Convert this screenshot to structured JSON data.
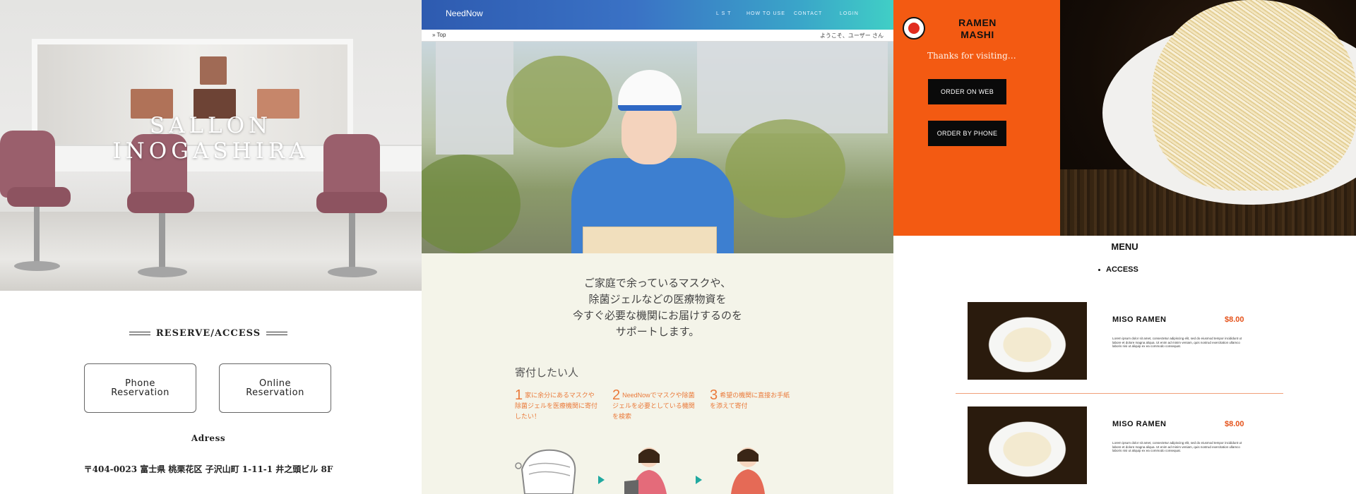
{
  "salon": {
    "title_line1": "SALLON",
    "title_line2": "INOGASHIRA",
    "section_title": "RESERVE/ACCESS",
    "phone_button": "Phone\nReservation",
    "online_button": "Online\nReservation",
    "address_heading": "Adress",
    "address": "〒404-0023 富士県 桃栗花区 子沢山町 1-11-1 井之頭ビル 8F"
  },
  "neednow": {
    "logo": "NeedNow",
    "nav": [
      "L S T",
      "HOW TO USE",
      "CONTACT",
      "LOGIN"
    ],
    "breadcrumb": "» Top",
    "greeting": "ようこそ、ユーザー さん",
    "intro": [
      "ご家庭で余っているマスクや、",
      "除菌ジェルなどの医療物資を",
      "今すぐ必要な機関にお届けするのを",
      "サポートします。"
    ],
    "donate_heading": "寄付したい人",
    "steps": [
      {
        "num": "1",
        "text": "家に余分にあるマスクや除菌ジェルを医療機関に寄付したい！"
      },
      {
        "num": "2",
        "text": "NeedNowでマスクや除菌ジェルを必要としている機関を検索"
      },
      {
        "num": "3",
        "text": "希望の機関に直接お手紙を添えて寄付"
      }
    ],
    "colors": {
      "header_start": "#2e5bb0",
      "header_end": "#40cfc6",
      "accent": "#ea7a3a"
    }
  },
  "ramen": {
    "name": "RAMEN\nMASHI",
    "thanks": "Thanks for visiting…",
    "order_web": "ORDER ON WEB",
    "order_phone": "ORDER BY PHONE",
    "menu_label": "MENU",
    "access_label": "ACCESS",
    "dishes": [
      {
        "name": "MISO  RAMEN",
        "price": "$8.00",
        "desc": "Lorem ipsum dolor sit amet, consectetur adipiscing elit, sed do eiusmod tempor incididunt ut labore et dolore magna aliqua. Ut enim ad minim veniam, quis nostrud exercitation ullamco laboris nisi ut aliquip ex ea commodo consequat."
      },
      {
        "name": "MISO  RAMEN",
        "price": "$8.00",
        "desc": "Lorem ipsum dolor sit amet, consectetur adipiscing elit, sed do eiusmod tempor incididunt ut labore et dolore magna aliqua. Ut enim ad minim veniam, quis nostrud exercitation ullamco laboris nisi ut aliquip ex ea commodo consequat."
      }
    ],
    "colors": {
      "brand": "#f35a12",
      "price": "#e5521a"
    }
  }
}
